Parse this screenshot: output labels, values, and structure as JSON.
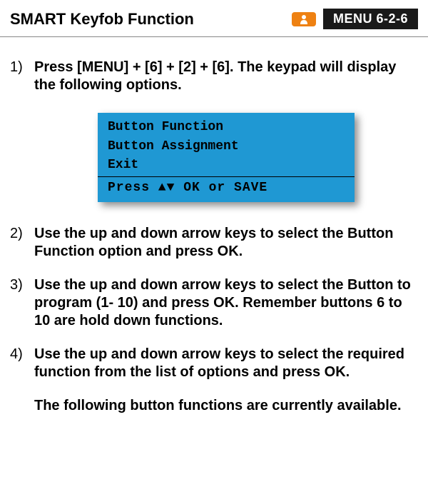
{
  "header": {
    "title": "SMART Keyfob Function",
    "icon_letter": "I",
    "menu_label": "MENU  6-2-6"
  },
  "steps": {
    "s1": "Press [MENU] + [6] + [2] + [6]. The keypad will display the following options.",
    "s2": "Use the up and down arrow keys to select the Button Function option and press OK.",
    "s3": "Use the up and down arrow keys to select the Button to program (1- 10) and press OK. Remember buttons 6 to 10 are hold down functions.",
    "s4": "Use the up and down arrow keys to select the required function from the list of options and press OK."
  },
  "screen": {
    "line1": "Button Function",
    "line2": "Button Assignment",
    "line3": "Exit",
    "prompt": "Press  ▲▼  OK  or  SAVE"
  },
  "trailing_paragraph": "The following button functions are currently available."
}
